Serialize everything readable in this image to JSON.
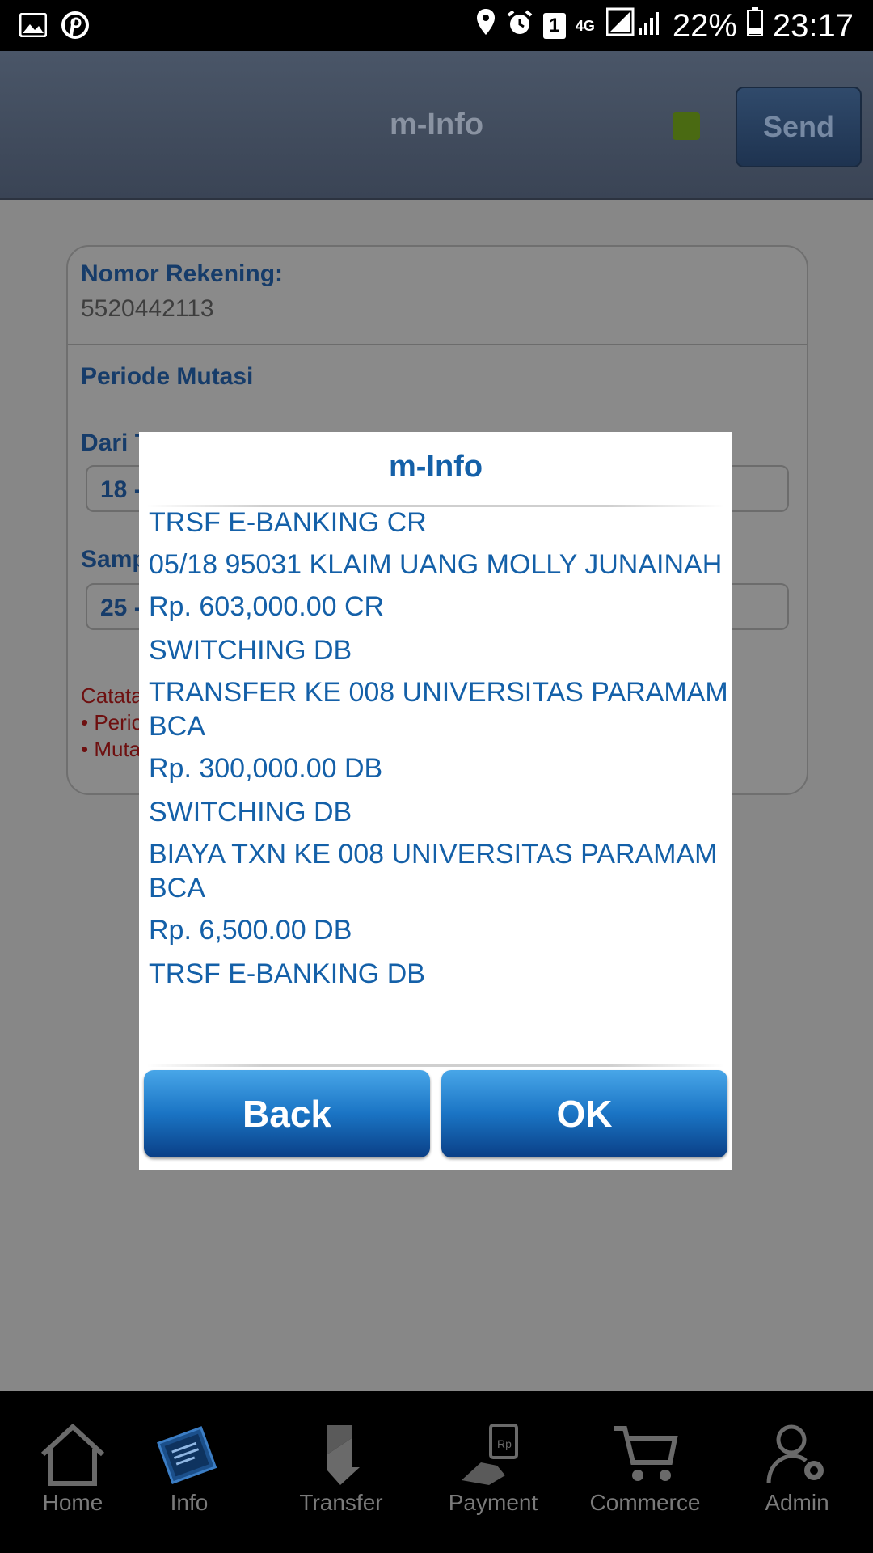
{
  "status_bar": {
    "battery": "22%",
    "time": "23:17",
    "network": "4G",
    "sim_badge": "1",
    "icons": [
      "image-icon",
      "pinterest-icon",
      "location-icon",
      "alarm-icon",
      "sim-icon",
      "network-icon",
      "signal-icon",
      "battery-icon"
    ]
  },
  "header": {
    "title": "m-Info",
    "send_label": "Send"
  },
  "form": {
    "account_label": "Nomor Rekening:",
    "account_number": "5520442113",
    "period_label": "Periode Mutasi",
    "from_label": "Dari T",
    "from_value": "18 -",
    "to_label": "Samp",
    "to_value": "25 -",
    "note_title": "Catata",
    "note_line1": "• Perio",
    "note_line2": "• Muta"
  },
  "modal": {
    "title": "m-Info",
    "transactions": [
      {
        "type": "TRSF E-BANKING CR",
        "desc": "05/18 95031 KLAIM UANG MOLLY JUNAINAH",
        "amount": "Rp. 603,000.00 CR"
      },
      {
        "type": "SWITCHING DB",
        "desc": "TRANSFER KE 008 UNIVERSITAS PARAMAM BCA",
        "amount": "Rp. 300,000.00 DB"
      },
      {
        "type": "SWITCHING DB",
        "desc": "BIAYA TXN KE 008 UNIVERSITAS PARAMAM BCA",
        "amount": "Rp. 6,500.00 DB"
      },
      {
        "type": "TRSF E-BANKING DB",
        "desc": "",
        "amount": ""
      }
    ],
    "back_label": "Back",
    "ok_label": "OK"
  },
  "bottom_nav": [
    {
      "label": "Home",
      "icon": "home-icon"
    },
    {
      "label": "Info",
      "icon": "info-icon"
    },
    {
      "label": "Transfer",
      "icon": "transfer-icon"
    },
    {
      "label": "Payment",
      "icon": "payment-icon"
    },
    {
      "label": "Commerce",
      "icon": "cart-icon"
    },
    {
      "label": "Admin",
      "icon": "admin-icon"
    }
  ],
  "colors": {
    "accent": "#1460a8",
    "button_top": "#48a6e8",
    "button_bottom": "#0a3f86",
    "status_led": "#4a6a12"
  }
}
